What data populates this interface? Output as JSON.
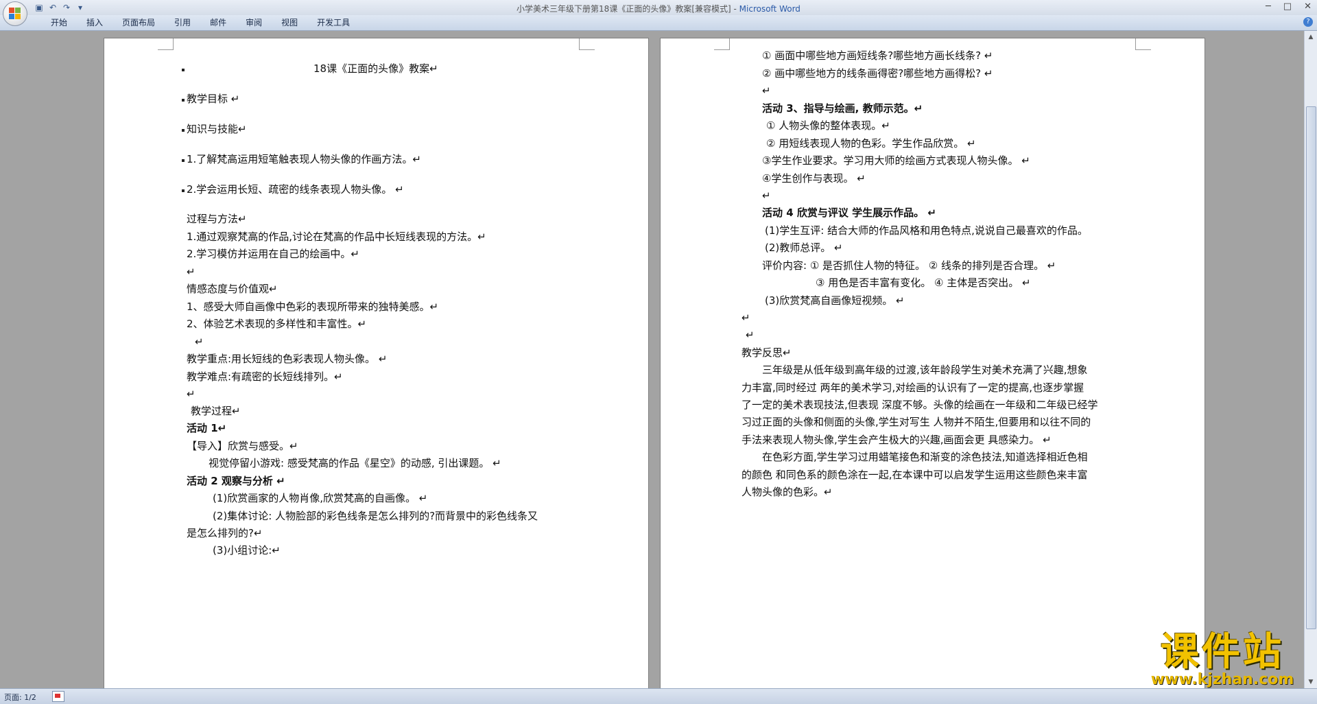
{
  "window": {
    "title_doc": "小学美术三年级下册第18课《正面的头像》教案[兼容模式] - ",
    "title_app": "Microsoft Word",
    "minimize": "─",
    "maximize": "□",
    "close": "✕"
  },
  "qat": {
    "save_icon": "save-icon",
    "undo_icon": "undo-icon",
    "redo_icon": "redo-icon",
    "more_icon": "dropdown-icon"
  },
  "ribbon": {
    "tabs": [
      "开始",
      "插入",
      "页面布局",
      "引用",
      "邮件",
      "审阅",
      "视图",
      "开发工具"
    ],
    "help": "?"
  },
  "page1": [
    {
      "text": "18课《正面的头像》教案↵",
      "bold": false
    },
    {
      "text": "教学目标 ↵",
      "bold": false
    },
    {
      "text": "知识与技能↵",
      "bold": false
    },
    {
      "text": "1.了解梵高运用短笔触表现人物头像的作画方法。↵",
      "bold": false
    },
    {
      "text": "2.学会运用长短、疏密的线条表现人物头像。 ↵",
      "bold": false
    },
    {
      "text": "过程与方法↵",
      "bold": false
    },
    {
      "text": "1.通过观察梵高的作品,讨论在梵高的作品中长短线表现的方法。↵",
      "bold": false
    },
    {
      "text": "2.学习模仿并运用在自己的绘画中。↵",
      "bold": false
    },
    {
      "text": "↵",
      "bold": false
    },
    {
      "text": "情感态度与价值观↵",
      "bold": false
    },
    {
      "text": "1、感受大师自画像中色彩的表现所带来的独特美感。↵",
      "bold": false
    },
    {
      "text": "2、体验艺术表现的多样性和丰富性。↵",
      "bold": false
    },
    {
      "text": "↵",
      "bold": false
    },
    {
      "text": "教学重点:用长短线的色彩表现人物头像。 ↵",
      "bold": false
    },
    {
      "text": "教学难点:有疏密的长短线排列。↵",
      "bold": false
    },
    {
      "text": "↵",
      "bold": false
    },
    {
      "text": "教学过程↵",
      "bold": false
    },
    {
      "text": "活动 1↵",
      "bold": true
    },
    {
      "text": "【导入】欣赏与感受。↵",
      "bold": false
    },
    {
      "text": "视觉停留小游戏: 感受梵高的作品《星空》的动感,  引出课题。 ↵",
      "bold": false
    },
    {
      "text": "活动 2    观察与分析 ↵",
      "bold": true
    },
    {
      "text": "(1)欣赏画家的人物肖像,欣赏梵高的自画像。 ↵",
      "bold": false
    },
    {
      "text": "(2)集体讨论: 人物脸部的彩色线条是怎么排列的?而背景中的彩色线条又",
      "bold": false
    },
    {
      "text": "是怎么排列的?↵",
      "bold": false
    },
    {
      "text": "(3)小组讨论:↵",
      "bold": false
    }
  ],
  "page2": [
    {
      "text": "① 画面中哪些地方画短线条?哪些地方画长线条? ↵",
      "bold": false
    },
    {
      "text": "② 画中哪些地方的线条画得密?哪些地方画得松? ↵",
      "bold": false
    },
    {
      "text": "↵",
      "bold": false
    },
    {
      "text": "活动 3、指导与绘画, 教师示范。↵",
      "bold": true
    },
    {
      "text": "① 人物头像的整体表现。↵",
      "bold": false
    },
    {
      "text": "② 用短线表现人物的色彩。学生作品欣赏。 ↵",
      "bold": false
    },
    {
      "text": "③学生作业要求。学习用大师的绘画方式表现人物头像。 ↵",
      "bold": false
    },
    {
      "text": "④学生创作与表现。 ↵",
      "bold": false
    },
    {
      "text": "↵",
      "bold": false
    },
    {
      "text": "活动 4 欣赏与评议 学生展示作品。 ↵",
      "bold": true
    },
    {
      "text": "(1)学生互评: 结合大师的作品风格和用色特点,说说自己最喜欢的作品。",
      "bold": false
    },
    {
      "text": "(2)教师总评。 ↵",
      "bold": false
    },
    {
      "text": "评价内容: ① 是否抓住人物的特征。 ② 线条的排列是否合理。 ↵",
      "bold": false
    },
    {
      "text": "③ 用色是否丰富有变化。 ④ 主体是否突出。 ↵",
      "bold": false
    },
    {
      "text": "(3)欣赏梵高自画像短视频。 ↵",
      "bold": false
    },
    {
      "text": "↵",
      "bold": false
    },
    {
      "text": "↵",
      "bold": false
    },
    {
      "text": "教学反思↵",
      "bold": false
    },
    {
      "text": "三年级是从低年级到高年级的过渡,该年龄段学生对美术充满了兴趣,想象",
      "bold": false
    },
    {
      "text": "力丰富,同时经过 两年的美术学习,对绘画的认识有了一定的提高,也逐步掌握",
      "bold": false
    },
    {
      "text": "了一定的美术表现技法,但表现 深度不够。头像的绘画在一年级和二年级已经学",
      "bold": false
    },
    {
      "text": "习过正面的头像和侧面的头像,学生对写生 人物并不陌生,但要用和以往不同的",
      "bold": false
    },
    {
      "text": "手法来表现人物头像,学生会产生极大的兴趣,画面会更 具感染力。 ↵",
      "bold": false
    },
    {
      "text": "在色彩方面,学生学习过用蜡笔接色和渐变的涂色技法,知道选择相近色相",
      "bold": false
    },
    {
      "text": "的颜色 和同色系的颜色涂在一起,在本课中可以启发学生运用这些颜色来丰富",
      "bold": false
    },
    {
      "text": "人物头像的色彩。↵",
      "bold": false
    }
  ],
  "status": {
    "page": "页面: 1/2"
  },
  "watermark": {
    "title": "课件站",
    "url": "www.kjzhan.com"
  }
}
